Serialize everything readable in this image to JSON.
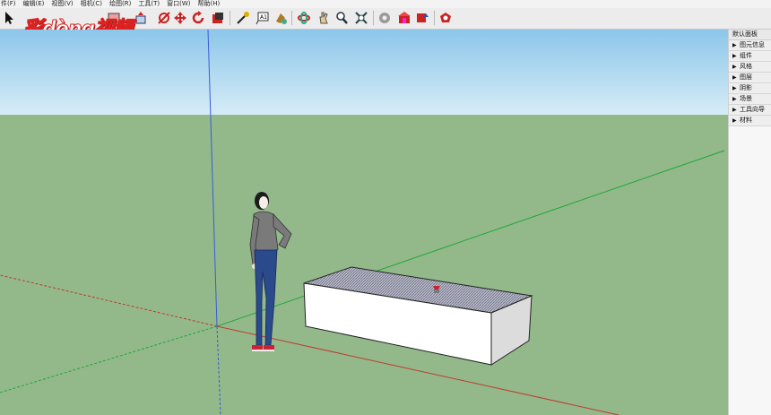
{
  "menu": [
    "件(F)",
    "编辑(E)",
    "视图(V)",
    "相机(C)",
    "绘图(R)",
    "工具(T)",
    "窗口(W)",
    "帮助(H)"
  ],
  "watermark": "彩dòng视频",
  "tray": {
    "title": "默认面板",
    "items": [
      "图元信息",
      "组件",
      "风格",
      "图层",
      "阴影",
      "场景",
      "工具向导",
      "材料"
    ]
  },
  "icons": [
    "select-arrow-icon",
    "eraser-icon",
    "paint-bucket-icon",
    "line-icon",
    "rectangle-icon",
    "push-pull-icon",
    "move-icon",
    "rotate-icon",
    "scale-icon",
    "tape-measure-icon",
    "text-icon",
    "paint-icon",
    "orbit-icon",
    "pan-icon",
    "zoom-icon",
    "zoom-extents-icon",
    "component-icon",
    "warehouse-icon",
    "share-icon",
    "extension-icon"
  ],
  "colors": {
    "sky": "#aed8f1",
    "ground": "#93b98b",
    "red_axis": "#c0392b",
    "green_axis": "#2ecc40",
    "blue_axis": "#3a5bd9"
  }
}
